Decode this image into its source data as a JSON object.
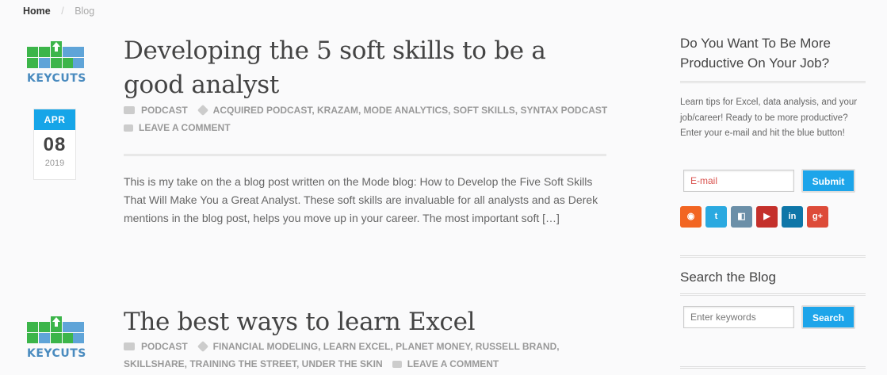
{
  "breadcrumb": {
    "home": "Home",
    "separator": "/",
    "current": "Blog"
  },
  "logo": {
    "text": "KEYCUTS"
  },
  "posts": [
    {
      "title": "Developing the 5 soft skills to be a good analyst",
      "date": {
        "month": "APR",
        "day": "08",
        "year": "2019"
      },
      "category": "PODCAST",
      "tags": "ACQUIRED PODCAST, KRAZAM, MODE ANALYTICS, SOFT SKILLS, SYNTAX PODCAST",
      "comment": "LEAVE A COMMENT",
      "excerpt": "This is my take on the a blog post written on the Mode blog: How to Develop the Five Soft Skills That Will Make You a Great Analyst. These soft skills are invaluable for all analysts and as Derek mentions in the blog post, helps you move up in your career. The most important soft […]"
    },
    {
      "title": "The best ways to learn Excel",
      "category": "PODCAST",
      "tags": "FINANCIAL MODELING, LEARN EXCEL, PLANET MONEY, RUSSELL BRAND, SKILLSHARE, TRAINING THE STREET, UNDER THE SKIN",
      "comment": "LEAVE A COMMENT"
    }
  ],
  "sidebar": {
    "newsletter": {
      "title": "Do You Want To Be More Productive On Your Job?",
      "description": "Learn tips for Excel, data analysis, and your job/career! Ready to be more productive? Enter your e-mail and hit the blue button!",
      "email_placeholder": "E-mail",
      "submit_label": "Submit"
    },
    "social_icons": [
      "rss-icon",
      "twitter-icon",
      "delicious-icon",
      "youtube-icon",
      "linkedin-icon",
      "google-plus-icon"
    ],
    "search": {
      "title": "Search the Blog",
      "placeholder": "Enter keywords",
      "button_label": "Search"
    }
  },
  "colors": {
    "accent": "#1da5ea",
    "logo_green": "#3cb54a",
    "logo_blue": "#4a8bbf"
  }
}
